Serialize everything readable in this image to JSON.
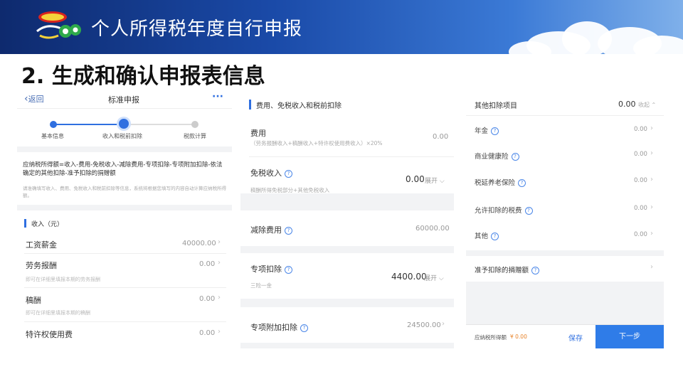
{
  "banner": {
    "title": "个人所得税年度自行申报",
    "logo_icon": "tax-mascot-logo"
  },
  "slide_title": "2. 生成和确认申报表信息",
  "screen1": {
    "back_label": "返回",
    "title": "标准申报",
    "more_label": "···",
    "steps": [
      {
        "label": "基本信息"
      },
      {
        "label": "收入和税前扣除"
      },
      {
        "label": "税款计算"
      }
    ],
    "formula": "应纳税所得额=收入-费用-免税收入-减除费用-专项扣除-专项附加扣除-依法确定的其他扣除-准予扣除的捐赠额",
    "note": "请准确填写收入、费用、免税收入和税前扣除等信息，系统将根据您填写的内容自动计算应纳税所得额。",
    "section_title": "收入（元）",
    "rows": [
      {
        "label": "工资薪金",
        "value": "40000.00",
        "hint": ""
      },
      {
        "label": "劳务报酬",
        "value": "0.00",
        "hint": "即可在详细里填报本期的劳务报酬"
      },
      {
        "label": "稿酬",
        "value": "0.00",
        "hint": "即可在详细里填报本期的稿酬"
      },
      {
        "label": "特许权使用费",
        "value": "0.00",
        "hint": ""
      }
    ]
  },
  "screen2": {
    "section_title": "费用、免税收入和税前扣除",
    "cost": {
      "label": "费用",
      "sub": "（劳务报酬收入+稿酬收入+特许权使用费收入）×20%",
      "value": "0.00"
    },
    "exempt": {
      "label": "免税收入",
      "sub": "稿酬所得免税部分+其他免税收入",
      "value": "0.00",
      "expand": "展开"
    },
    "deduct": {
      "label": "减除费用",
      "value": "60000.00"
    },
    "special": {
      "label": "专项扣除",
      "sub": "三险一金",
      "value": "4400.00",
      "expand": "展开"
    },
    "special_add": {
      "label": "专项附加扣除",
      "value": "24500.00"
    }
  },
  "screen3": {
    "other": {
      "label": "其他扣除项目",
      "value": "0.00",
      "collapse": "收起"
    },
    "items": [
      {
        "label": "年金",
        "value": "0.00"
      },
      {
        "label": "商业健康险",
        "value": "0.00"
      },
      {
        "label": "税延养老保险",
        "value": "0.00"
      },
      {
        "label": "允许扣除的税费",
        "value": "0.00"
      },
      {
        "label": "其他",
        "value": "0.00"
      }
    ],
    "donation": {
      "label": "准予扣除的捐赠额"
    },
    "footer": {
      "taxable_label": "应纳税所得额",
      "taxable_value": "¥ 0.00",
      "save": "保存",
      "next": "下一步"
    }
  },
  "colors": {
    "primary": "#2f6fe0",
    "banner": "#1a4aa8",
    "accent_orange": "#e8832a"
  }
}
